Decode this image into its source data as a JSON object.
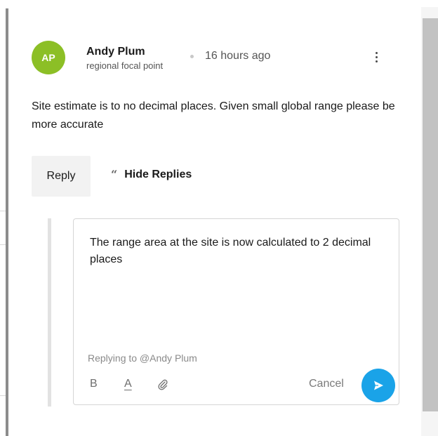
{
  "comment": {
    "avatar_initials": "AP",
    "avatar_color": "#8cbf26",
    "author_name": "Andy Plum",
    "author_role": "regional focal point",
    "timestamp": "16 hours ago",
    "body": "Site estimate is to no decimal places. Given small global range please be more accurate",
    "menu_icon": "kebab-icon"
  },
  "actions": {
    "reply_label": "Reply",
    "hide_replies_label": "Hide Replies",
    "hide_replies_icon": "quote-icon"
  },
  "reply_editor": {
    "text": "The range area at the site is now calculated to 2 decimal places",
    "replying_to": "Replying to @Andy Plum",
    "toolbar": {
      "bold_label": "B",
      "text_color_label": "A",
      "attach_icon": "paperclip-icon"
    },
    "cancel_label": "Cancel",
    "send_icon": "send-icon",
    "send_color": "#1aa3e8"
  }
}
